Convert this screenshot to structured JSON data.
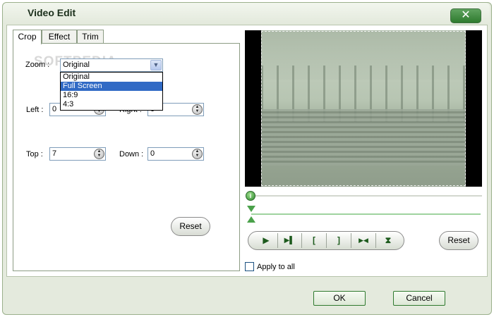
{
  "window": {
    "title": "Video Edit",
    "close_symbol": "✕"
  },
  "tabs": [
    {
      "label": "Crop",
      "active": true
    },
    {
      "label": "Effect",
      "active": false
    },
    {
      "label": "Trim",
      "active": false
    }
  ],
  "watermark": "SOFTPEDIA",
  "crop": {
    "zoom_label": "Zoom :",
    "zoom_value": "Original",
    "zoom_options": [
      "Original",
      "Full Screen",
      "16:9",
      "4:3"
    ],
    "zoom_highlighted": "Full Screen",
    "left_label": "Left :",
    "left_value": "0",
    "right_label": "Right :",
    "right_value": "0",
    "top_label": "Top :",
    "top_value": "7",
    "down_label": "Down :",
    "down_value": "0",
    "reset_label": "Reset"
  },
  "player": {
    "reset_label": "Reset",
    "apply_all_label": "Apply to all",
    "apply_all_checked": false,
    "controls": [
      {
        "name": "play-icon",
        "glyph": "▶"
      },
      {
        "name": "next-frame-icon",
        "glyph": "▶▌"
      },
      {
        "name": "mark-in-icon",
        "glyph": "["
      },
      {
        "name": "mark-out-icon",
        "glyph": "]"
      },
      {
        "name": "trim-joint-icon",
        "glyph": "▶◀"
      },
      {
        "name": "split-icon",
        "glyph": "⧗"
      }
    ],
    "seek_icon_glyph": "i"
  },
  "footer": {
    "ok_label": "OK",
    "cancel_label": "Cancel"
  },
  "colors": {
    "accent_green": "#2e7a2e",
    "selection_blue": "#316ac5",
    "dialog_bg": "#e4eadd"
  }
}
